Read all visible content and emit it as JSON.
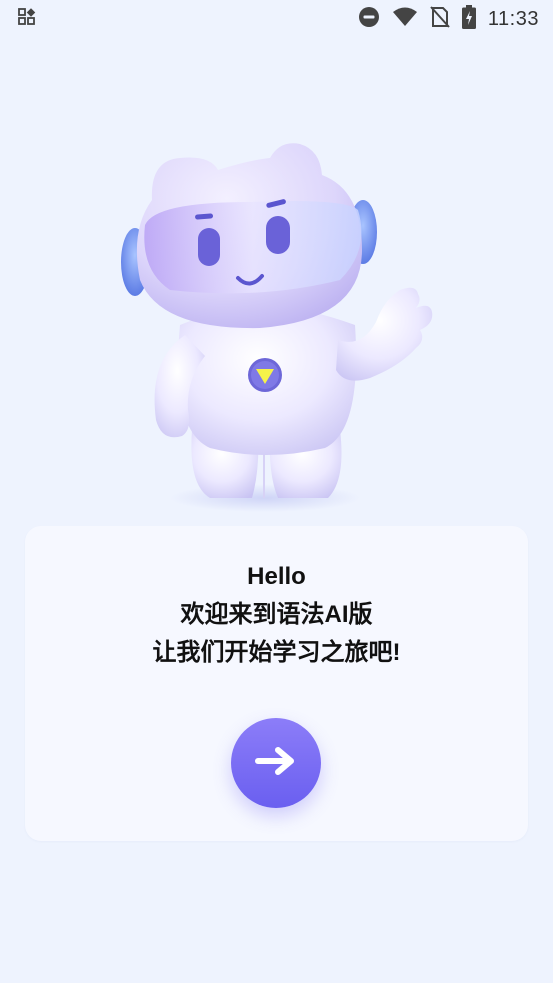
{
  "status_bar": {
    "time": "11:33",
    "icons": [
      "apps-grid-icon",
      "do-not-disturb-icon",
      "wifi-icon",
      "no-sim-icon",
      "battery-charging-icon"
    ]
  },
  "mascot": {
    "icon": "robot-mascot-waving"
  },
  "welcome": {
    "line1": "Hello",
    "line2": "欢迎来到语法AI版",
    "line3": "让我们开始学习之旅吧!"
  },
  "next_button": {
    "icon": "arrow-right-icon"
  },
  "colors": {
    "background": "#eef3fe",
    "card": "#f6f8ff",
    "accent_top": "#8c7df8",
    "accent_bottom": "#6a5ff0"
  }
}
